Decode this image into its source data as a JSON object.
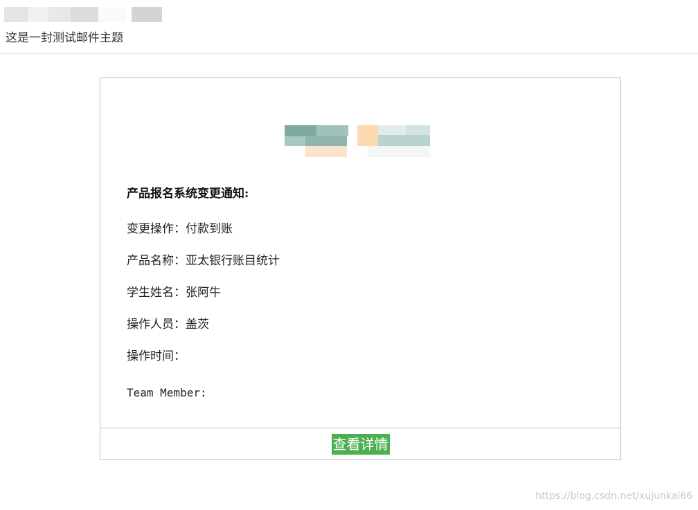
{
  "header": {
    "subject": "这是一封测试邮件主题"
  },
  "notice": {
    "title": "产品报名系统变更通知:",
    "fields": [
      {
        "label": "变更操作",
        "sep": "：",
        "value": "付款到账"
      },
      {
        "label": "产品名称",
        "sep": "：",
        "value": "亚太银行账目统计"
      },
      {
        "label": "学生姓名",
        "sep": "：",
        "value": "张阿牛"
      },
      {
        "label": "操作人员",
        "sep": "：",
        "value": "盖茨"
      },
      {
        "label": "操作时间",
        "sep": "：",
        "value": ""
      }
    ],
    "team_label": "Team Member:"
  },
  "footer": {
    "button_label": "查看详情",
    "button_color": "#4caf50"
  },
  "watermark": "https://blog.csdn.net/xujunkai66"
}
